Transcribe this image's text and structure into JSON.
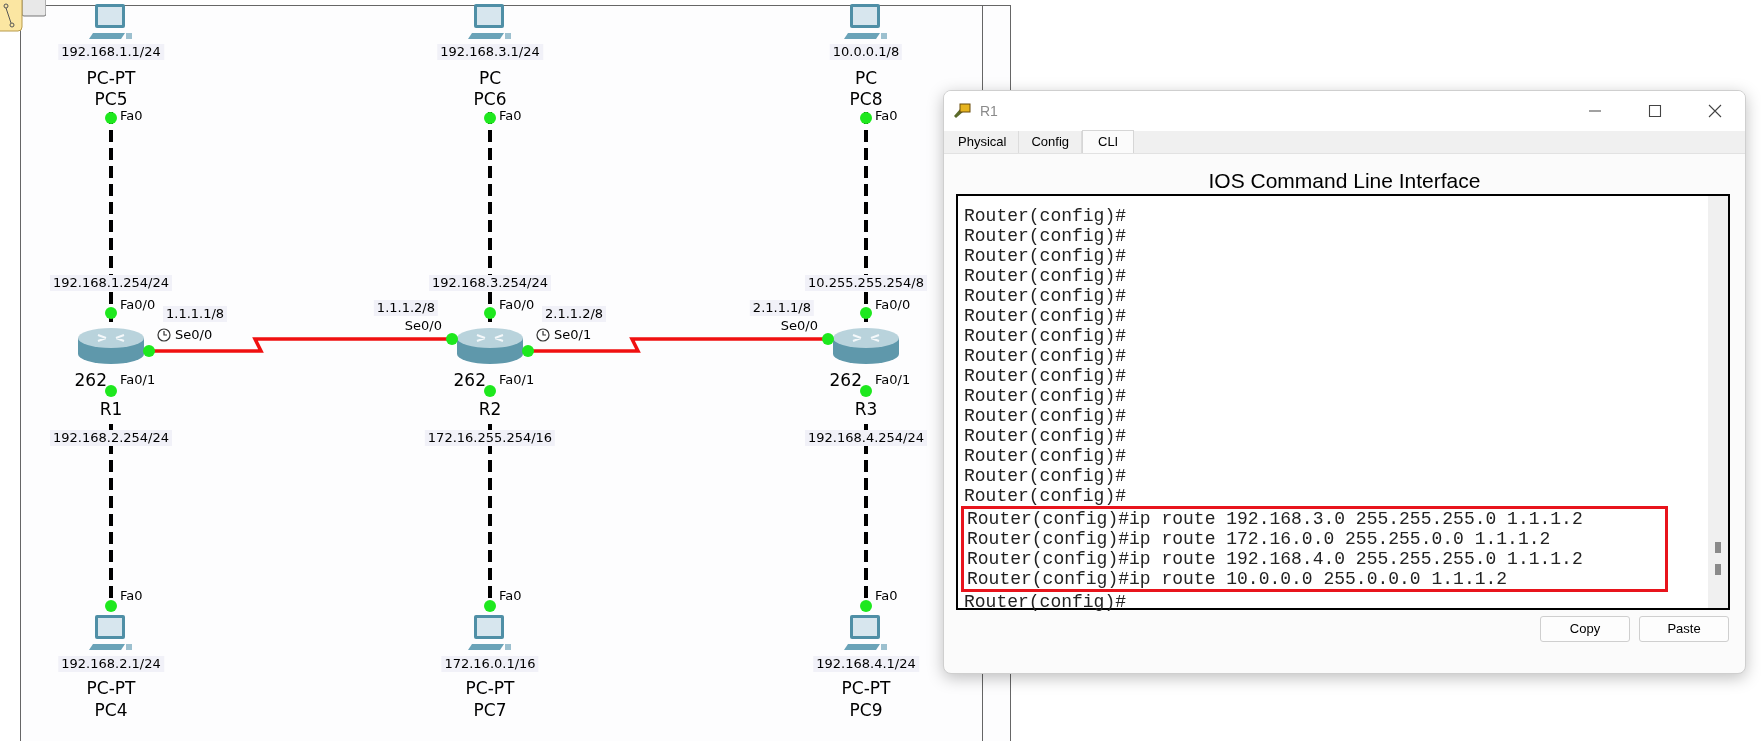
{
  "topology": {
    "columns": [
      {
        "top_pc": {
          "ip": "192.168.1.1/24",
          "model": "PC-PT",
          "name": "PC5",
          "port": "Fa0"
        },
        "router": {
          "top_ip": "192.168.1.254/24",
          "top_port": "Fa0/0",
          "model": "262",
          "name": "R1",
          "bottom_port": "Fa0/1",
          "bottom_ip": "192.168.2.254/24"
        },
        "bottom_pc": {
          "port": "Fa0",
          "ip": "192.168.2.1/24",
          "model": "PC-PT",
          "name": "PC4"
        }
      },
      {
        "top_pc": {
          "ip": "192.168.3.1/24",
          "model": "PC",
          "name": "PC6",
          "port": "Fa0"
        },
        "router": {
          "top_ip": "192.168.3.254/24",
          "top_port": "Fa0/0",
          "model": "262",
          "name": "R2",
          "bottom_port": "Fa0/1",
          "bottom_ip": "172.16.255.254/16"
        },
        "bottom_pc": {
          "port": "Fa0",
          "ip": "172.16.0.1/16",
          "model": "PC-PT",
          "name": "PC7"
        }
      },
      {
        "top_pc": {
          "ip": "10.0.0.1/8",
          "model": "PC",
          "name": "PC8",
          "port": "Fa0"
        },
        "router": {
          "top_ip": "10.255.255.254/8",
          "top_port": "Fa0/0",
          "model": "262",
          "name": "R3",
          "bottom_port": "Fa0/1",
          "bottom_ip": "192.168.4.254/24"
        },
        "bottom_pc": {
          "port": "Fa0",
          "ip": "192.168.4.1/24",
          "model": "PC-PT",
          "name": "PC9"
        }
      }
    ],
    "serial_links": [
      {
        "left_ip": "1.1.1.1/8",
        "left_port": "Se0/0",
        "left_clock": true,
        "right_ip": "1.1.1.2/8",
        "right_port": "Se0/0",
        "right_clock": false
      },
      {
        "left_ip": "2.1.1.2/8",
        "left_port": "Se0/1",
        "left_clock": true,
        "right_ip": "2.1.1.1/8",
        "right_port": "Se0/0",
        "right_clock": false
      }
    ]
  },
  "cli_window": {
    "title": "R1",
    "tabs": [
      {
        "label": "Physical",
        "selected": false
      },
      {
        "label": "Config",
        "selected": false
      },
      {
        "label": "CLI",
        "selected": true
      }
    ],
    "heading": "IOS Command Line Interface",
    "lines": [
      {
        "text": "Router(config)#",
        "highlighted": false
      },
      {
        "text": "Router(config)#",
        "highlighted": false
      },
      {
        "text": "Router(config)#",
        "highlighted": false
      },
      {
        "text": "Router(config)#",
        "highlighted": false
      },
      {
        "text": "Router(config)#",
        "highlighted": false
      },
      {
        "text": "Router(config)#",
        "highlighted": false
      },
      {
        "text": "Router(config)#",
        "highlighted": false
      },
      {
        "text": "Router(config)#",
        "highlighted": false
      },
      {
        "text": "Router(config)#",
        "highlighted": false
      },
      {
        "text": "Router(config)#",
        "highlighted": false
      },
      {
        "text": "Router(config)#",
        "highlighted": false
      },
      {
        "text": "Router(config)#",
        "highlighted": false
      },
      {
        "text": "Router(config)#",
        "highlighted": false
      },
      {
        "text": "Router(config)#",
        "highlighted": false
      },
      {
        "text": "Router(config)#",
        "highlighted": false
      },
      {
        "text": "Router(config)#ip route 192.168.3.0 255.255.255.0 1.1.1.2",
        "highlighted": true
      },
      {
        "text": "Router(config)#ip route 172.16.0.0 255.255.0.0 1.1.1.2",
        "highlighted": true
      },
      {
        "text": "Router(config)#ip route 192.168.4.0 255.255.255.0 1.1.1.2",
        "highlighted": true
      },
      {
        "text": "Router(config)#ip route 10.0.0.0 255.0.0.0 1.1.1.2",
        "highlighted": true
      },
      {
        "text": "Router(config)#",
        "highlighted": false
      }
    ],
    "buttons": [
      "Copy",
      "Paste"
    ]
  }
}
